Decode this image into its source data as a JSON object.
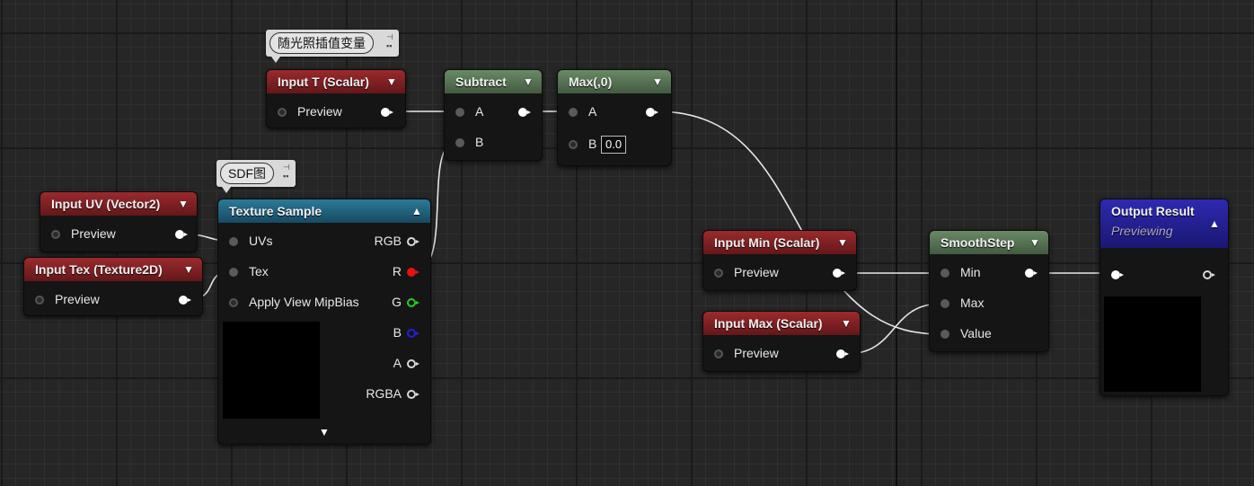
{
  "comments": [
    {
      "text": "随光照插值变量"
    },
    {
      "text": "SDF图"
    }
  ],
  "nodes": {
    "input_t": {
      "title": "Input T (Scalar)",
      "pin": "Preview"
    },
    "subtract": {
      "title": "Subtract",
      "pin_a": "A",
      "pin_b": "B"
    },
    "max": {
      "title": "Max(,0)",
      "pin_a": "A",
      "pin_b": "B",
      "b_value": "0.0"
    },
    "input_uv": {
      "title": "Input UV (Vector2)",
      "pin": "Preview"
    },
    "input_tex": {
      "title": "Input Tex (Texture2D)",
      "pin": "Preview"
    },
    "texture_sample": {
      "title": "Texture Sample",
      "inputs": [
        "UVs",
        "Tex",
        "Apply View MipBias"
      ],
      "outputs": [
        "RGB",
        "R",
        "G",
        "B",
        "A",
        "RGBA"
      ]
    },
    "input_min": {
      "title": "Input Min (Scalar)",
      "pin": "Preview"
    },
    "input_max": {
      "title": "Input Max (Scalar)",
      "pin": "Preview"
    },
    "smoothstep": {
      "title": "SmoothStep",
      "inputs": [
        "Min",
        "Max",
        "Value"
      ]
    },
    "output": {
      "title": "Output Result",
      "subtitle": "Previewing"
    }
  },
  "colors": {
    "header_red": "#8a2326",
    "header_green": "#5a7857",
    "header_blue": "#226580",
    "header_purple": "#2623a0",
    "pin_r": "#e81010",
    "pin_g": "#21d021",
    "pin_b": "#2020dd"
  },
  "icons": [
    "chevron-down-icon",
    "chevron-up-icon",
    "pin-icon"
  ]
}
